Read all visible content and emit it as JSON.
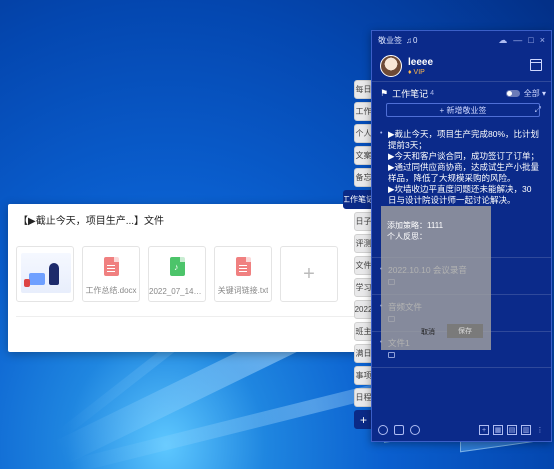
{
  "panel": {
    "app_name": "敬业签",
    "bell_count": "0",
    "username": "leeee",
    "vip": "VIP",
    "category": "工作笔记",
    "category_count": "4",
    "filter": "全部",
    "new_note": "+ 新增敬业签"
  },
  "side_tabs": [
    "每日",
    "工作",
    "个人",
    "文案",
    "备忘",
    "工作笔记",
    "日子",
    "评测",
    "文件",
    "学习",
    "2022",
    "班主",
    "满日",
    "事项",
    "日程",
    "+"
  ],
  "notes": [
    {
      "lines": [
        "▶截止今天，项目生产完成80%，比计划",
        "提前3天；",
        "▶今天和客户谈合同，成功签订了订单；",
        "▶通过同供应商协商，达成试生产小批量",
        "样品，降低了大规模采购的风险。",
        "▶坎墙收边平直度问题还未能解决，30",
        "日与设计院设计师一起讨论解决。"
      ]
    },
    {
      "lines": [
        "2022.10.10 会议录音"
      ]
    },
    {
      "lines": [
        "音频文件"
      ]
    },
    {
      "lines": [
        "文件1"
      ]
    }
  ],
  "overlay": {
    "line1": "添加策略：1111",
    "line2": "个人反思：",
    "cancel": "取消",
    "save": "保存"
  },
  "file_popup": {
    "title": "【▶截止今天，项目生产...】文件",
    "files": [
      "",
      "工作总结.docx",
      "2022_07_14_0...",
      "关键词链接.txt"
    ]
  }
}
